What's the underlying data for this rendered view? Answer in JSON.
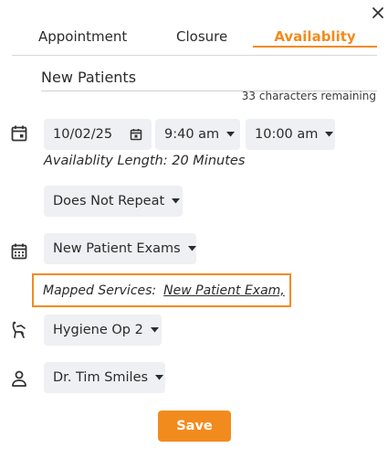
{
  "tabs": [
    {
      "label": "Appointment"
    },
    {
      "label": "Closure"
    },
    {
      "label": "Availablity"
    }
  ],
  "title_field": {
    "value": "New Patients"
  },
  "char_remaining": "33 characters remaining",
  "date": {
    "value": "10/02/25"
  },
  "start_time": {
    "value": "9:40 am"
  },
  "end_time": {
    "value": "10:00 am"
  },
  "availability_length": {
    "label": "Availablity Length",
    "value": "20 Minutes"
  },
  "repeat": {
    "value": "Does Not Repeat"
  },
  "service": {
    "value": "New Patient Exams"
  },
  "mapped_services": {
    "label": "Mapped Services:",
    "value": "New Patient Exam,"
  },
  "operatory": {
    "value": "Hygiene Op 2"
  },
  "provider": {
    "value": "Dr. Tim Smiles"
  },
  "save_label": "Save",
  "colors": {
    "accent": "#f28b1e",
    "pill_bg": "#eef0f3"
  },
  "icons": [
    "close-icon",
    "calendar-icon",
    "calendar-small-icon",
    "chevron-down-icon",
    "calendar-grid-icon",
    "dental-chair-icon",
    "person-icon"
  ]
}
